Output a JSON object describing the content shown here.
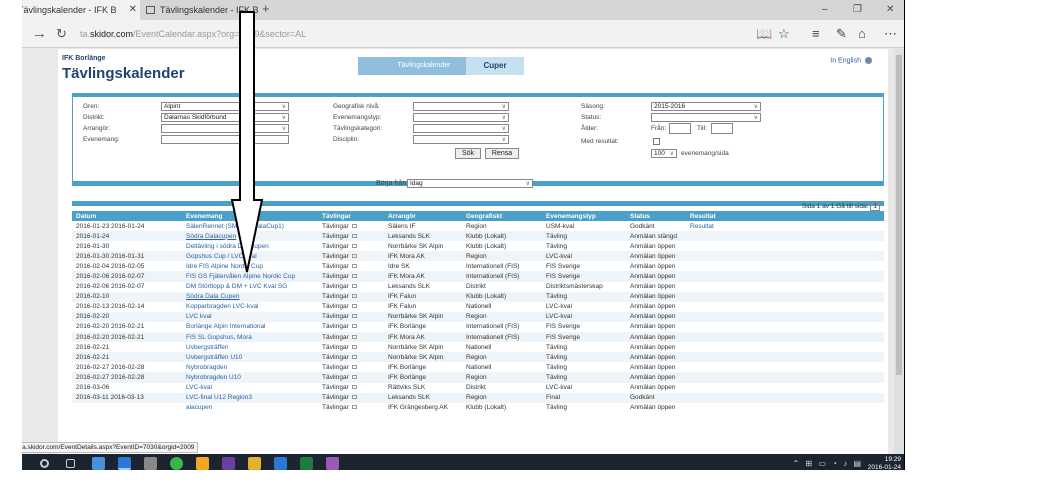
{
  "browser": {
    "tabs": [
      {
        "label": "Tävlingskalender - IFK B",
        "active": true
      },
      {
        "label": "Tävlingskalender - IFK Bor",
        "active": false
      }
    ],
    "new_tab": "+",
    "url_prefix": "ta.",
    "url_domain": "skidor.com",
    "url_rest": "/EventCalendar.aspx?org=2009&sector=AL",
    "window_controls": [
      "–",
      "❐",
      "✕"
    ],
    "status_url": "http://ta.skidor.com/EventDetails.aspx?EventID=7030&orgid=2009"
  },
  "page": {
    "org": "IFK Borlänge",
    "title": "Tävlingskalender",
    "english_link": "In English",
    "tabs": [
      "Tävlingskalender",
      "Cuper"
    ]
  },
  "filters": {
    "gren_label": "Gren:",
    "gren_value": "Alpint",
    "distrikt_label": "Distrikt:",
    "distrikt_value": "Dalarnas Skidförbund",
    "arrangor_label": "Arrangör:",
    "evenemang_label": "Evenemang:",
    "geo_label": "Geografisk nivå:",
    "evtyp_label": "Evenemangstyp:",
    "tavkat_label": "Tävlingskategori:",
    "disciplin_label": "Disciplin:",
    "sasong_label": "Säsong:",
    "sasong_value": "2015-2016",
    "status_label": "Status:",
    "alder_label": "Ålder:",
    "fran_label": "Från:",
    "till_label": "Till:",
    "medresultat_label": "Med resultat:",
    "per_page_value": "100",
    "per_page_label": "evenemang/sida",
    "sok_button": "Sök",
    "rensa_button": "Rensa",
    "borja_label": "Börja från:",
    "borja_value": "Idag"
  },
  "pager": {
    "text": "Sida 1 av 1   Gå till sida:",
    "page": "1"
  },
  "table": {
    "headers": [
      "Datum",
      "Evenemang",
      "Tävlingar",
      "Arrangör",
      "Geografiskt",
      "Evenemangstyp",
      "Status",
      "Resultat"
    ],
    "rows": [
      [
        "2016-01-23 2016-01-24",
        "SälenRennet (SM-kval/DalaCup1)",
        "Tävlingar",
        "Sälens IF",
        "Region",
        "USM-kval",
        "Godkänt",
        "Resultat"
      ],
      [
        "2016-01-24",
        "Södra Dalacupen",
        "Tävlingar",
        "Leksands SLK",
        "Klubb (Lokalt)",
        "Tävling",
        "Anmälan stängd",
        ""
      ],
      [
        "2016-01-30",
        "Deltävling i södra Dalacupen",
        "Tävlingar",
        "Norrbärke SK Alpin",
        "Klubb (Lokalt)",
        "Tävling",
        "Anmälan öppen",
        ""
      ],
      [
        "2016-01-30 2016-01-31",
        "Gopshus Cup / LVC kval",
        "Tävlingar",
        "IFK Mora AK",
        "Region",
        "LVC-kval",
        "Anmälan öppen",
        ""
      ],
      [
        "2016-02-04 2016-02-05",
        "Idre FIS Alpine Nordic Cup",
        "Tävlingar",
        "Idre SK",
        "Internationell (FIS)",
        "FIS Sverige",
        "Anmälan öppen",
        ""
      ],
      [
        "2016-02-06 2016-02-07",
        "FIS GS Fjätervålen Alpine Nordic Cup",
        "Tävlingar",
        "IFK Mora AK",
        "Internationell (FIS)",
        "FIS Sverige",
        "Anmälan öppen",
        ""
      ],
      [
        "2016-02-06 2016-02-07",
        "DM Störtlopp & DM + LVC Kval SG",
        "Tävlingar",
        "Leksands SLK",
        "Distrikt",
        "Distriktsmästerskap",
        "Anmälan öppen",
        ""
      ],
      [
        "2016-02-10",
        "Södra Dala Cupen",
        "Tävlingar",
        "IFK Falun",
        "Klubb (Lokalt)",
        "Tävling",
        "Anmälan öppen",
        ""
      ],
      [
        "2016-02-13 2016-02-14",
        "Kopparbragden LVC-kval",
        "Tävlingar",
        "IFK Falun",
        "Nationell",
        "LVC-kval",
        "Anmälan öppen",
        ""
      ],
      [
        "2016-02-20",
        "LVC kval",
        "Tävlingar",
        "Norrbärke SK Alpin",
        "Region",
        "LVC-kval",
        "Anmälan öppen",
        ""
      ],
      [
        "2016-02-20 2016-02-21",
        "Borlänge Alpin International",
        "Tävlingar",
        "IFK Borlänge",
        "Internationell (FIS)",
        "FIS Sverige",
        "Anmälan öppen",
        ""
      ],
      [
        "2016-02-20 2016-02-21",
        "FIS SL Gopshus, Mora",
        "Tävlingar",
        "IFK Mora AK",
        "Internationell (FIS)",
        "FIS Sverige",
        "Anmälan öppen",
        ""
      ],
      [
        "2016-02-21",
        "Uvbergsträffen",
        "Tävlingar",
        "Norrbärke SK Alpin",
        "Nationell",
        "Tävling",
        "Anmälan öppen",
        ""
      ],
      [
        "2016-02-21",
        "Uvbergsträffen U10",
        "Tävlingar",
        "Norrbärke SK Alpin",
        "Region",
        "Tävling",
        "Anmälan öppen",
        ""
      ],
      [
        "2016-02-27 2016-02-28",
        "Nybrobragden",
        "Tävlingar",
        "IFK Borlänge",
        "Nationell",
        "Tävling",
        "Anmälan öppen",
        ""
      ],
      [
        "2016-02-27 2016-02-28",
        "Nybrobragden U10",
        "Tävlingar",
        "IFK Borlänge",
        "Region",
        "Tävling",
        "Anmälan öppen",
        ""
      ],
      [
        "2016-03-06",
        "LVC-kval",
        "Tävlingar",
        "Rättviks SLK",
        "Distrikt",
        "LVC-kval",
        "Anmälan öppen",
        ""
      ],
      [
        "2016-03-11 2016-03-13",
        "LVC-final U12 Region3",
        "Tävlingar",
        "Leksands SLK",
        "Region",
        "Final",
        "Godkänt",
        ""
      ],
      [
        "",
        "alacupen",
        "Tävlingar",
        "IFK Grängesberg AK",
        "Klubb (Lokalt)",
        "Tävling",
        "Anmälan öppen",
        ""
      ]
    ]
  },
  "taskbar": {
    "time": "19:29",
    "date": "2016-01-24"
  },
  "colors": {
    "accent": "#4aa0c8",
    "title": "#1e4470",
    "link": "#2a62a8"
  }
}
